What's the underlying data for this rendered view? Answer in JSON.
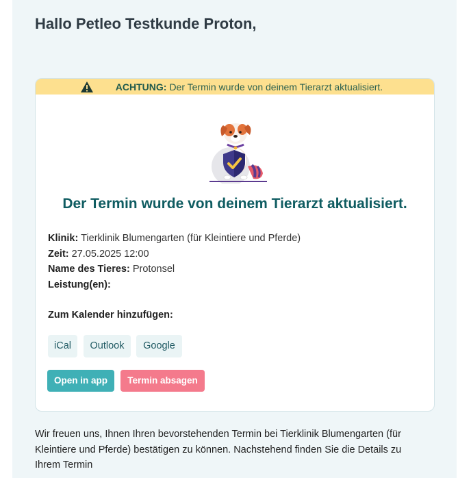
{
  "greeting": "Hallo Petleo Testkunde Proton,",
  "warning": {
    "label": "ACHTUNG:",
    "text": "Der Termin wurde von deinem Tierarzt aktualisiert.",
    "icon": "warning-triangle-icon",
    "background": "#fde08f"
  },
  "card": {
    "illustration": "dog-with-shield-illustration",
    "title": "Der Termin wurde von deinem Tierarzt aktualisiert.",
    "details": {
      "clinic_label": "Klinik:",
      "clinic_value": "Tierklinik Blumengarten (für Kleintiere und Pferde)",
      "time_label": "Zeit:",
      "time_value": "27.05.2025 12:00",
      "pet_label": "Name des Tieres:",
      "pet_value": "Protonsel",
      "services_label": "Leistung(en):",
      "services_value": ""
    },
    "calendar_heading": "Zum Kalender hinzufügen:",
    "calendar_buttons": {
      "ical": "iCal",
      "outlook": "Outlook",
      "google": "Google"
    },
    "actions": {
      "open_in_app": "Open in app",
      "cancel": "Termin absagen"
    }
  },
  "footer": {
    "line1": "Wir freuen uns, Ihnen Ihren bevorstehenden Termin bei Tierklinik Blumengarten (für",
    "line2": "Kleintiere und Pferde) bestätigen zu können. Nachstehend finden Sie die Details zu",
    "line3": "Ihrem Termin"
  },
  "colors": {
    "title": "#0f5c61",
    "primary_button": "#3fb0b6",
    "danger_button": "#f47a8c",
    "page_background": "#eff6f8"
  }
}
